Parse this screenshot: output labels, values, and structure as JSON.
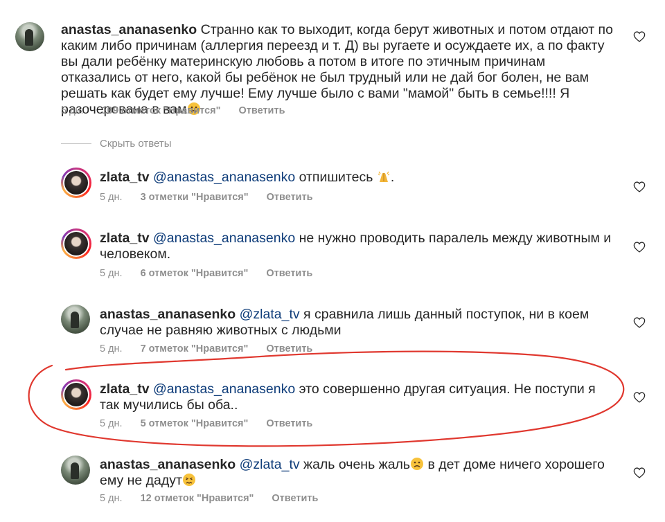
{
  "colors": {
    "text": "#262626",
    "mention": "#0f3d7a",
    "meta": "#8e8e8e",
    "highlight": "#e0382f"
  },
  "main_comment": {
    "username": "anastas_ananasenko",
    "text": "Странно как то выходит, когда берут животных и потом отдают по каким либо причинам (аллергия переезд и т. Д) вы ругаете и осуждаете их, а по факту вы дали ребёнку материнскую любовь а потом в итоге по этичным причинам отказались от него, какой бы ребёнок не был трудный или не дай бог болен, не вам решать как будет ему лучше! Ему лучше было с вами \"мамой\" быть в семье!!!! Я разочерована  в вам",
    "emoji": "sad-face",
    "time": "5 дн.",
    "likes": "109 отметок \"Нравится\"",
    "reply": "Ответить"
  },
  "hide_replies": "Скрыть ответы",
  "replies": [
    {
      "username": "zlata_tv",
      "mention": "@anastas_ananasenko",
      "text": " отпишитесь ",
      "emoji_after": "praying-hands",
      "tail": ".",
      "time": "5 дн.",
      "likes": "3 отметки \"Нравится\"",
      "reply": "Ответить"
    },
    {
      "username": "zlata_tv",
      "mention": "@anastas_ananasenko",
      "text": " не нужно проводить паралель между животным и человеком.",
      "time": "5 дн.",
      "likes": "6 отметок \"Нравится\"",
      "reply": "Ответить"
    },
    {
      "username": "anastas_ananasenko",
      "mention": "@zlata_tv",
      "text": " я сравнила лишь данный поступок, ни в коем случае не равняю животных с людьми",
      "time": "5 дн.",
      "likes": "7 отметок \"Нравится\"",
      "reply": "Ответить"
    },
    {
      "username": "zlata_tv",
      "mention": "@anastas_ananasenko",
      "text": " это совершенно другая ситуация. Не поступи я так мучились бы оба..",
      "time": "5 дн.",
      "likes": "5 отметок \"Нравится\"",
      "reply": "Ответить"
    },
    {
      "username": "anastas_ananasenko",
      "mention": "@zlata_tv",
      "text_a": " жаль очень жаль",
      "text_b": " в дет доме ничего хорошего ему не дадут",
      "time": "5 дн.",
      "likes": "12 отметок \"Нравится\"",
      "reply": "Ответить"
    }
  ],
  "icons": {
    "like": "heart-outline-icon",
    "avatar_a": "avatar-anastas",
    "avatar_z": "avatar-zlata"
  }
}
